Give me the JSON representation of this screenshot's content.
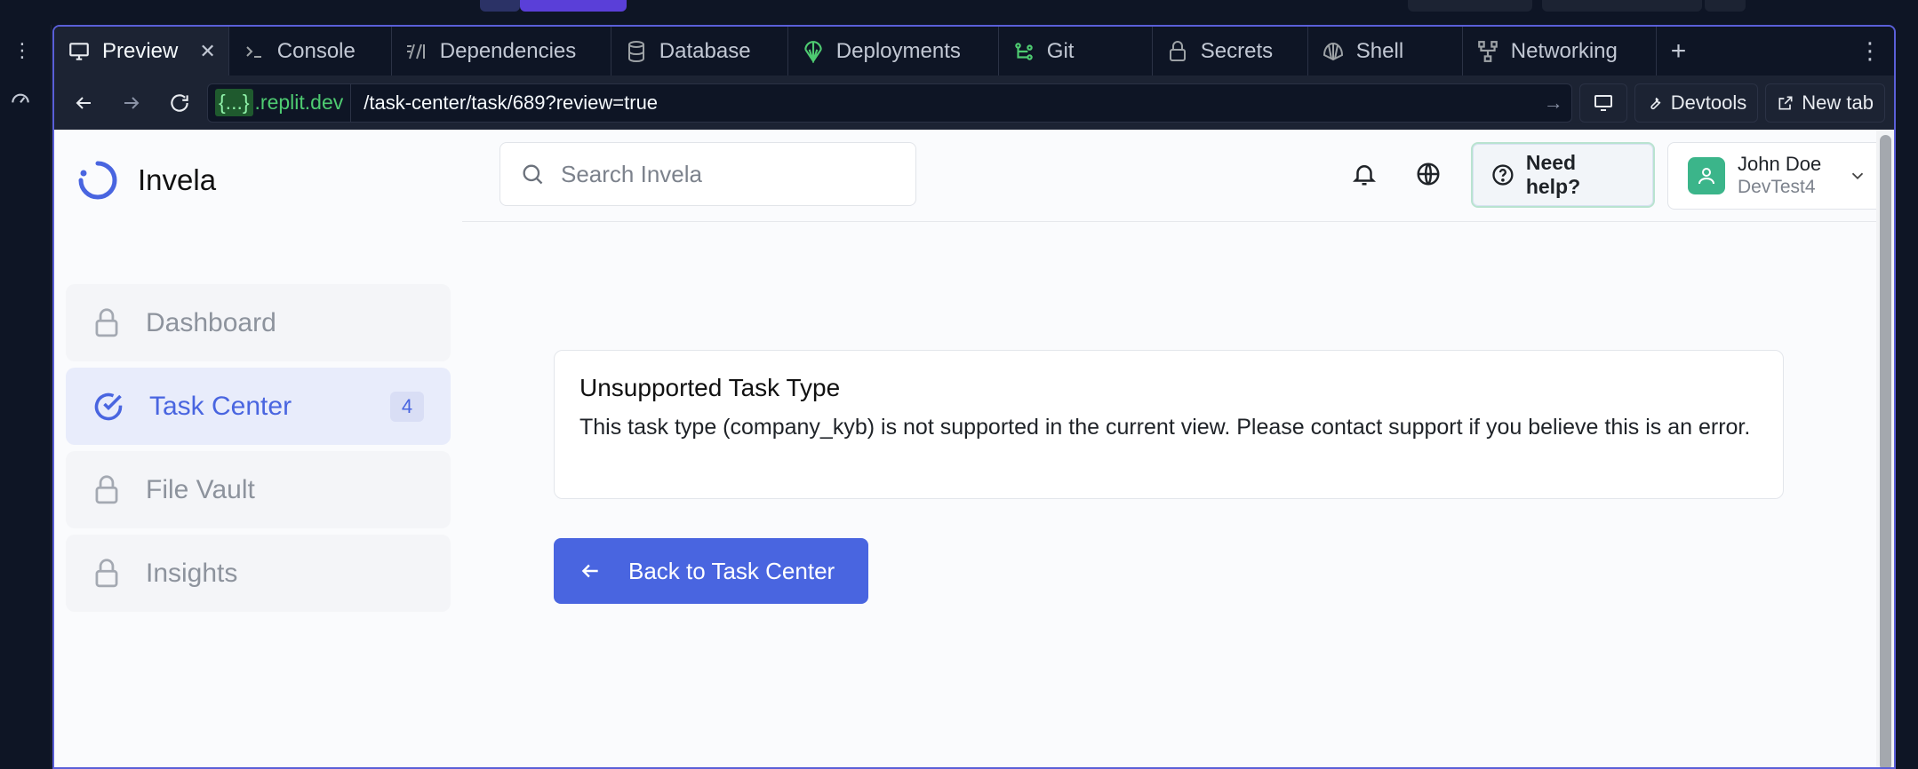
{
  "ide": {
    "tabs": [
      {
        "label": "Preview",
        "icon": "monitor-icon",
        "active": true
      },
      {
        "label": "Console",
        "icon": "terminal-icon"
      },
      {
        "label": "Dependencies",
        "icon": "dependencies-icon"
      },
      {
        "label": "Database",
        "icon": "database-icon"
      },
      {
        "label": "Deployments",
        "icon": "deployments-icon"
      },
      {
        "label": "Git",
        "icon": "git-icon"
      },
      {
        "label": "Secrets",
        "icon": "lock-icon"
      },
      {
        "label": "Shell",
        "icon": "shell-icon"
      },
      {
        "label": "Networking",
        "icon": "networking-icon"
      }
    ],
    "url": {
      "domain_brace": "{...}",
      "domain_suffix": ".replit.dev",
      "path": "/task-center/task/689?review=true"
    },
    "devtools_label": "Devtools",
    "new_tab_label": "New tab"
  },
  "app": {
    "brand": "Invela",
    "search_placeholder": "Search Invela",
    "help_label": "Need help?",
    "user": {
      "name": "John Doe",
      "org": "DevTest4"
    },
    "nav": [
      {
        "label": "Dashboard",
        "icon": "lock-icon",
        "locked": true
      },
      {
        "label": "Task Center",
        "icon": "check-circle-icon",
        "badge": "4",
        "active": true
      },
      {
        "label": "File Vault",
        "icon": "lock-icon",
        "locked": true
      },
      {
        "label": "Insights",
        "icon": "lock-icon",
        "locked": true
      }
    ],
    "card": {
      "title": "Unsupported Task Type",
      "message": "This task type (company_kyb) is not supported in the current view. Please contact support if you believe this is an error."
    },
    "back_button": "Back to Task Center"
  },
  "colors": {
    "accent": "#4965e0",
    "ide_bg": "#0e1525",
    "ide_panel": "#1c2333",
    "panel_border": "#5a5fd8",
    "url_green": "#4ecb71"
  }
}
